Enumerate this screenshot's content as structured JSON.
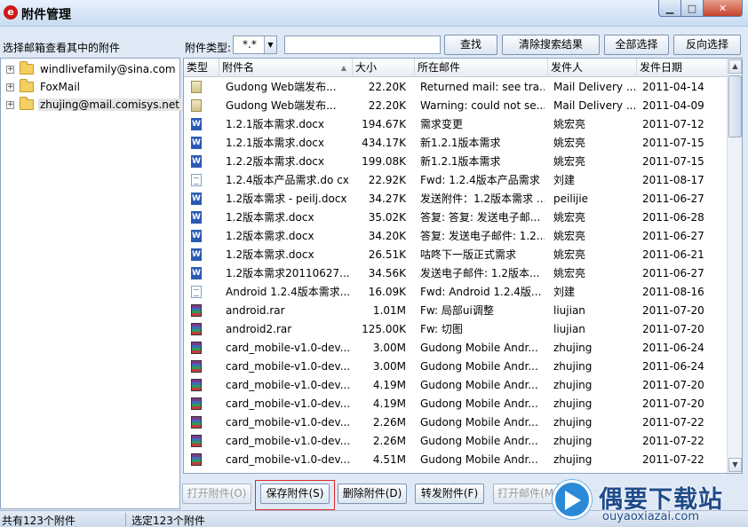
{
  "window": {
    "title": "附件管理",
    "min": "▁",
    "max": "□",
    "close": "✕"
  },
  "toolbar": {
    "left_label": "选择邮箱查看其中的附件",
    "type_label": "附件类型:",
    "type_value": "*.*",
    "search_value": "",
    "search_button": "查找",
    "clear_button": "清除搜索结果",
    "select_all_button": "全部选择",
    "invert_button": "反向选择"
  },
  "tree": [
    {
      "label": "windlivefamily@sina.com"
    },
    {
      "label": "FoxMail"
    },
    {
      "label": "zhujing@mail.comisys.net"
    }
  ],
  "list": {
    "columns": [
      "类型",
      "附件名",
      "大小",
      "所在邮件",
      "发件人",
      "发件日期"
    ],
    "rows": [
      {
        "icon": "generic-file-icon",
        "name": "Gudong Web端发布...",
        "size": "22.20K",
        "mail": "Returned mail: see tra...",
        "sender": "Mail Delivery ...",
        "date": "2011-04-14"
      },
      {
        "icon": "generic-file-icon",
        "name": "Gudong Web端发布...",
        "size": "22.20K",
        "mail": "Warning: could not se...",
        "sender": "Mail Delivery ...",
        "date": "2011-04-09"
      },
      {
        "icon": "word-doc-icon",
        "name": "1.2.1版本需求.docx",
        "size": "194.67K",
        "mail": "需求变更",
        "sender": "姚宏亮",
        "date": "2011-07-12"
      },
      {
        "icon": "word-doc-icon",
        "name": "1.2.1版本需求.docx",
        "size": "434.17K",
        "mail": "新1.2.1版本需求",
        "sender": "姚宏亮",
        "date": "2011-07-15"
      },
      {
        "icon": "word-doc-icon",
        "name": "1.2.2版本需求.docx",
        "size": "199.08K",
        "mail": "新1.2.1版本需求",
        "sender": "姚宏亮",
        "date": "2011-07-15"
      },
      {
        "icon": "plain-doc-icon",
        "name": "1.2.4版本产品需求.do cx",
        "size": "22.92K",
        "mail": "Fwd: 1.2.4版本产品需求",
        "sender": "刘建",
        "date": "2011-08-17"
      },
      {
        "icon": "word-doc-icon",
        "name": "1.2版本需求 - peilj.docx",
        "size": "34.27K",
        "mail": "发送附件：1.2版本需求 ...",
        "sender": "peilijie",
        "date": "2011-06-27"
      },
      {
        "icon": "word-doc-icon",
        "name": "1.2版本需求.docx",
        "size": "35.02K",
        "mail": "答复: 答复: 发送电子邮...",
        "sender": "姚宏亮",
        "date": "2011-06-28"
      },
      {
        "icon": "word-doc-icon",
        "name": "1.2版本需求.docx",
        "size": "34.20K",
        "mail": "答复: 发送电子邮件: 1.2...",
        "sender": "姚宏亮",
        "date": "2011-06-27"
      },
      {
        "icon": "word-doc-icon",
        "name": "1.2版本需求.docx",
        "size": "26.51K",
        "mail": "咕咚下一版正式需求",
        "sender": "姚宏亮",
        "date": "2011-06-21"
      },
      {
        "icon": "word-doc-icon",
        "name": "1.2版本需求20110627....",
        "size": "34.56K",
        "mail": "发送电子邮件: 1.2版本...",
        "sender": "姚宏亮",
        "date": "2011-06-27"
      },
      {
        "icon": "plain-doc-icon",
        "name": "Android 1.2.4版本需求....",
        "size": "16.09K",
        "mail": "Fwd: Android 1.2.4版...",
        "sender": "刘建",
        "date": "2011-08-16"
      },
      {
        "icon": "rar-archive-icon",
        "name": "android.rar",
        "size": "1.01M",
        "mail": "Fw: 局部ui调整",
        "sender": "liujian",
        "date": "2011-07-20"
      },
      {
        "icon": "rar-archive-icon",
        "name": "android2.rar",
        "size": "125.00K",
        "mail": "Fw: 切图",
        "sender": "liujian",
        "date": "2011-07-20"
      },
      {
        "icon": "rar-archive-icon",
        "name": "card_mobile-v1.0-dev...",
        "size": "3.00M",
        "mail": "Gudong Mobile Andr...",
        "sender": "zhujing",
        "date": "2011-06-24"
      },
      {
        "icon": "rar-archive-icon",
        "name": "card_mobile-v1.0-dev...",
        "size": "3.00M",
        "mail": "Gudong Mobile Andr...",
        "sender": "zhujing",
        "date": "2011-06-24"
      },
      {
        "icon": "rar-archive-icon",
        "name": "card_mobile-v1.0-dev...",
        "size": "4.19M",
        "mail": "Gudong Mobile Andr...",
        "sender": "zhujing",
        "date": "2011-07-20"
      },
      {
        "icon": "rar-archive-icon",
        "name": "card_mobile-v1.0-dev...",
        "size": "4.19M",
        "mail": "Gudong Mobile Andr...",
        "sender": "zhujing",
        "date": "2011-07-20"
      },
      {
        "icon": "rar-archive-icon",
        "name": "card_mobile-v1.0-dev...",
        "size": "2.26M",
        "mail": "Gudong Mobile Andr...",
        "sender": "zhujing",
        "date": "2011-07-22"
      },
      {
        "icon": "rar-archive-icon",
        "name": "card_mobile-v1.0-dev...",
        "size": "2.26M",
        "mail": "Gudong Mobile Andr...",
        "sender": "zhujing",
        "date": "2011-07-22"
      },
      {
        "icon": "rar-archive-icon",
        "name": "card_mobile-v1.0-dev...",
        "size": "4.51M",
        "mail": "Gudong Mobile Andr...",
        "sender": "zhujing",
        "date": "2011-07-22"
      }
    ]
  },
  "actions": {
    "open": "打开附件(O)",
    "save": "保存附件(S)",
    "delete": "删除附件(D)",
    "forward": "转发附件(F)",
    "open_mail": "打开邮件(M)"
  },
  "status": {
    "total": "共有123个附件",
    "selected": "选定123个附件"
  },
  "watermark": {
    "title": "偶要下载站",
    "url": "ouyaoxiazai.com"
  },
  "colors": {
    "highlight": "#e0282a",
    "app_icon": "#d01818"
  }
}
